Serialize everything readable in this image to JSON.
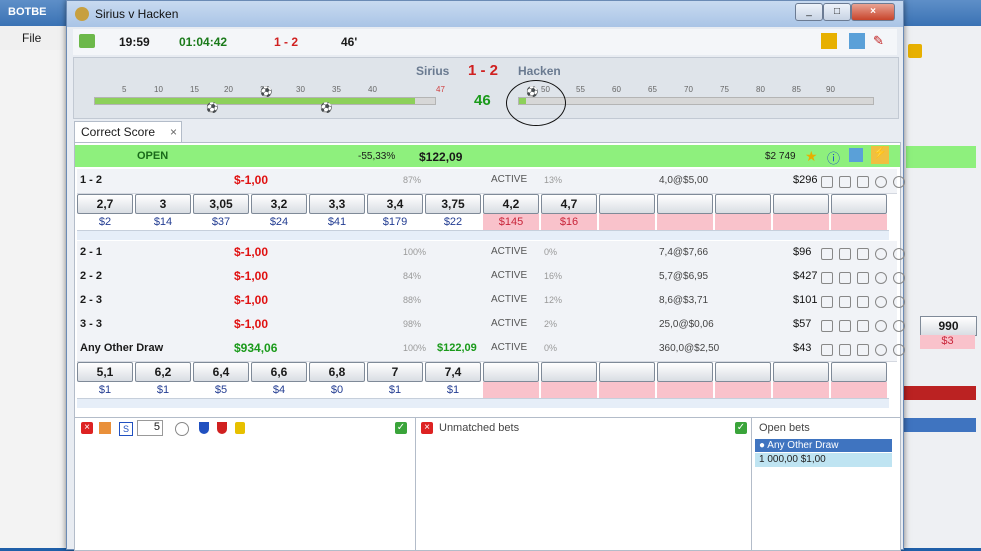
{
  "background_app": {
    "title": "BOTBE",
    "menu_file": "File",
    "right_value": "990",
    "right_stake": "$3",
    "right_tick": "90"
  },
  "window": {
    "title": "Sirius v Hacken",
    "time": "19:59",
    "elapsed": "01:04:42",
    "score": "1 - 2",
    "minute": "46'"
  },
  "match": {
    "home": "Sirius",
    "score": "1 - 2",
    "away": "Hacken",
    "minute": "46",
    "timeline_ticks": [
      "5",
      "10",
      "15",
      "20",
      "25",
      "30",
      "35",
      "40",
      "47",
      "50",
      "55",
      "60",
      "65",
      "70",
      "75",
      "80",
      "85",
      "90"
    ],
    "progress": 0.53
  },
  "tab": {
    "label": "Correct Score",
    "close": "×"
  },
  "market_header": {
    "status": "OPEN",
    "percent": "-55,33%",
    "profit": "$122,09",
    "matched": "$2 749"
  },
  "rows": [
    {
      "label": "1 - 2",
      "pl": "$-1,00",
      "pct": "87%",
      "status": "ACTIVE",
      "pct2": "13%",
      "odds": "4,0@$5,00",
      "amount": "$296"
    },
    {
      "label": "2 - 1",
      "pl": "$-1,00",
      "pct": "100%",
      "status": "ACTIVE",
      "pct2": "0%",
      "odds": "7,4@$7,66",
      "amount": "$96"
    },
    {
      "label": "2 - 2",
      "pl": "$-1,00",
      "pct": "84%",
      "status": "ACTIVE",
      "pct2": "16%",
      "odds": "5,7@$6,95",
      "amount": "$427"
    },
    {
      "label": "2 - 3",
      "pl": "$-1,00",
      "pct": "88%",
      "status": "ACTIVE",
      "pct2": "12%",
      "odds": "8,6@$3,71",
      "amount": "$101"
    },
    {
      "label": "3 - 3",
      "pl": "$-1,00",
      "pct": "98%",
      "status": "ACTIVE",
      "pct2": "2%",
      "odds": "25,0@$0,06",
      "amount": "$57"
    },
    {
      "label": "Any Other Draw",
      "pl": "$934,06",
      "pct": "100%",
      "extra": "$122,09",
      "status": "ACTIVE",
      "pct2": "0%",
      "odds": "360,0@$2,50",
      "amount": "$43"
    }
  ],
  "ladder_1_2": {
    "back": [
      "2,7",
      "3",
      "3,05",
      "3,2",
      "3,3",
      "3,4",
      "3,75"
    ],
    "back_stakes": [
      "$2",
      "$14",
      "$37",
      "$24",
      "$41",
      "$179",
      "$22"
    ],
    "lay": [
      "4,2",
      "4,7"
    ],
    "lay_stakes": [
      "$145",
      "$16"
    ]
  },
  "ladder_aod": {
    "back": [
      "5,1",
      "6,2",
      "6,4",
      "6,6",
      "6,8",
      "7",
      "7,4"
    ],
    "back_stakes": [
      "$1",
      "$1",
      "$5",
      "$4",
      "$0",
      "$1",
      "$1"
    ]
  },
  "bottom": {
    "stepper_value": "5",
    "unmatched_label": "Unmatched bets",
    "open_bets_label": "Open bets",
    "open_bet_name": "Any Other Draw",
    "open_bet_values": "1 000,00   $1,00"
  },
  "colors": {
    "green": "#8ef07d",
    "pink": "#f9c2cb",
    "red": "#e01010",
    "pl_green": "#1a9a1a"
  }
}
